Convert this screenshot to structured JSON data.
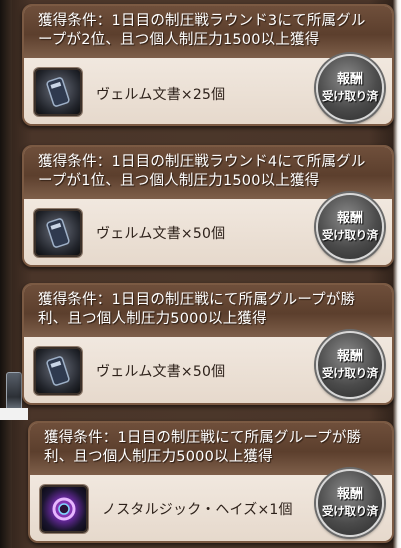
{
  "rewards": [
    {
      "condition": "獲得条件：1日目の制圧戦ラウンド3にて所属グループが2位、且つ個人制圧力1500以上獲得",
      "item": "ヴェルム文書×25個",
      "icon": "vellum-document-icon",
      "claim_top": "報酬",
      "claim_bottom": "受け取り済"
    },
    {
      "condition": "獲得条件：1日目の制圧戦ラウンド4にて所属グループが1位、且つ個人制圧力1500以上獲得",
      "item": "ヴェルム文書×50個",
      "icon": "vellum-document-icon",
      "claim_top": "報酬",
      "claim_bottom": "受け取り済"
    },
    {
      "condition": "獲得条件：1日目の制圧戦にて所属グループが勝利、且つ個人制圧力5000以上獲得",
      "item": "ヴェルム文書×50個",
      "icon": "vellum-document-icon",
      "claim_top": "報酬",
      "claim_bottom": "受け取り済"
    },
    {
      "condition": "獲得条件：1日目の制圧戦にて所属グループが勝利、且つ個人制圧力5000以上獲得",
      "item": "ノスタルジック・ヘイズ×1個",
      "icon": "nostalgic-haze-orb-icon",
      "claim_top": "報酬",
      "claim_bottom": "受け取り済"
    }
  ],
  "colors": {
    "header": "#5c3f2d",
    "body": "#ece2d8",
    "claimed_button": "#4b4b4b"
  }
}
